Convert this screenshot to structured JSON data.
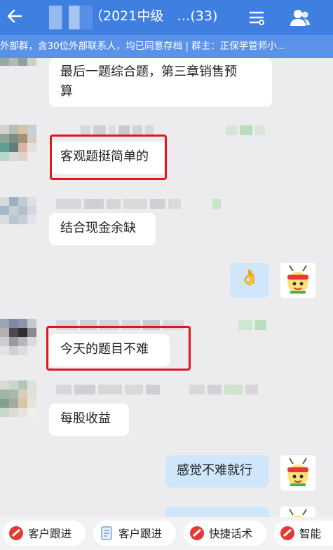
{
  "header": {
    "title": "（2021中级　…(33)",
    "notice": "外部群，含30位外部联系人，均已同意存档 | 群主：正保学管师小..."
  },
  "messages": [
    {
      "text_lines": [
        "最后一题综合题，第三章销售预",
        "算"
      ]
    },
    {
      "text": "客观题挺简单的"
    },
    {
      "text": "结合现金余缺"
    },
    {
      "emoji": "👌"
    },
    {
      "text": "今天的题目不难"
    },
    {
      "text": "每股收益"
    },
    {
      "text": "感觉不难就行"
    }
  ],
  "toolbar": [
    {
      "label": "客户跟进",
      "icon": "no-entry-red-icon"
    },
    {
      "label": "客户跟进",
      "icon": "document-icon"
    },
    {
      "label": "快捷话术",
      "icon": "no-entry-red-icon"
    },
    {
      "label": "智能",
      "icon": "no-entry-red-icon"
    }
  ],
  "colors": {
    "header": "#3f7fe0",
    "notice": "#5a92e9",
    "highlight": "#e2161b",
    "my_bubble": "#cfe6fb"
  }
}
